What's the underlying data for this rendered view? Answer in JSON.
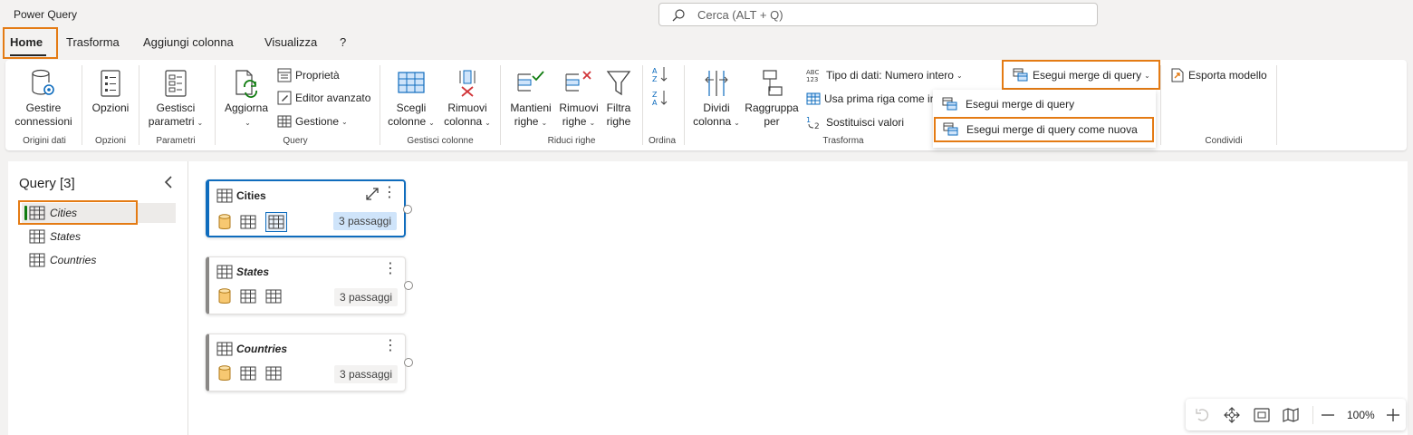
{
  "app": {
    "title": "Power Query"
  },
  "search": {
    "placeholder": "Cerca (ALT + Q)"
  },
  "tabs": [
    {
      "label": "Home"
    },
    {
      "label": "Trasforma"
    },
    {
      "label": "Aggiungi colonna"
    },
    {
      "label": "Visualizza"
    },
    {
      "label": "?"
    }
  ],
  "ribbon": {
    "origini_dati": {
      "label": "Origini dati",
      "gestire": "Gestire connessioni"
    },
    "opzioni": {
      "label": "Opzioni",
      "opzioni_btn": "Opzioni"
    },
    "parametri": {
      "label": "Parametri",
      "gestisci_1": "Gestisci",
      "gestisci_2": "parametri"
    },
    "query": {
      "label": "Query",
      "aggiorna": "Aggiorna",
      "proprieta": "Proprietà",
      "editor": "Editor avanzato",
      "gestione": "Gestione"
    },
    "gestisci_colonne": {
      "label": "Gestisci colonne",
      "scegli_1": "Scegli",
      "scegli_2": "colonne",
      "rimuovi_1": "Rimuovi",
      "rimuovi_2": "colonna"
    },
    "riduci_righe": {
      "label": "Riduci righe",
      "mantieni_1": "Mantieni",
      "mantieni_2": "righe",
      "rimuovi_1": "Rimuovi",
      "rimuovi_2": "righe",
      "filtra_1": "Filtra",
      "filtra_2": "righe"
    },
    "ordina": {
      "label": "Ordina"
    },
    "trasforma": {
      "label": "Trasforma",
      "dividi_1": "Dividi",
      "dividi_2": "colonna",
      "raggruppa_1": "Raggruppa",
      "raggruppa_2": "per",
      "tipo_dati": "Tipo di dati: Numero intero",
      "prima_riga": "Usa prima riga come in",
      "sostituisci": "Sostituisci valori"
    },
    "combina": {
      "merge": "Esegui merge di query"
    },
    "condividi": {
      "label": "Condividi",
      "esporta": "Esporta modello"
    }
  },
  "dropdown": {
    "items": [
      {
        "label": "Esegui merge di query"
      },
      {
        "label": "Esegui merge di query come nuova"
      }
    ]
  },
  "left_pane": {
    "title": "Query [3]",
    "items": [
      {
        "label": "Cities"
      },
      {
        "label": "States"
      },
      {
        "label": "Countries"
      }
    ]
  },
  "cards": [
    {
      "title": "Cities",
      "badge": "3 passaggi"
    },
    {
      "title": "States",
      "badge": "3 passaggi"
    },
    {
      "title": "Countries",
      "badge": "3 passaggi"
    }
  ],
  "zoom": {
    "value": "100%"
  },
  "colors": {
    "accent": "#e47b14",
    "selection": "#0f6cbd",
    "active_marker": "#107c10"
  }
}
